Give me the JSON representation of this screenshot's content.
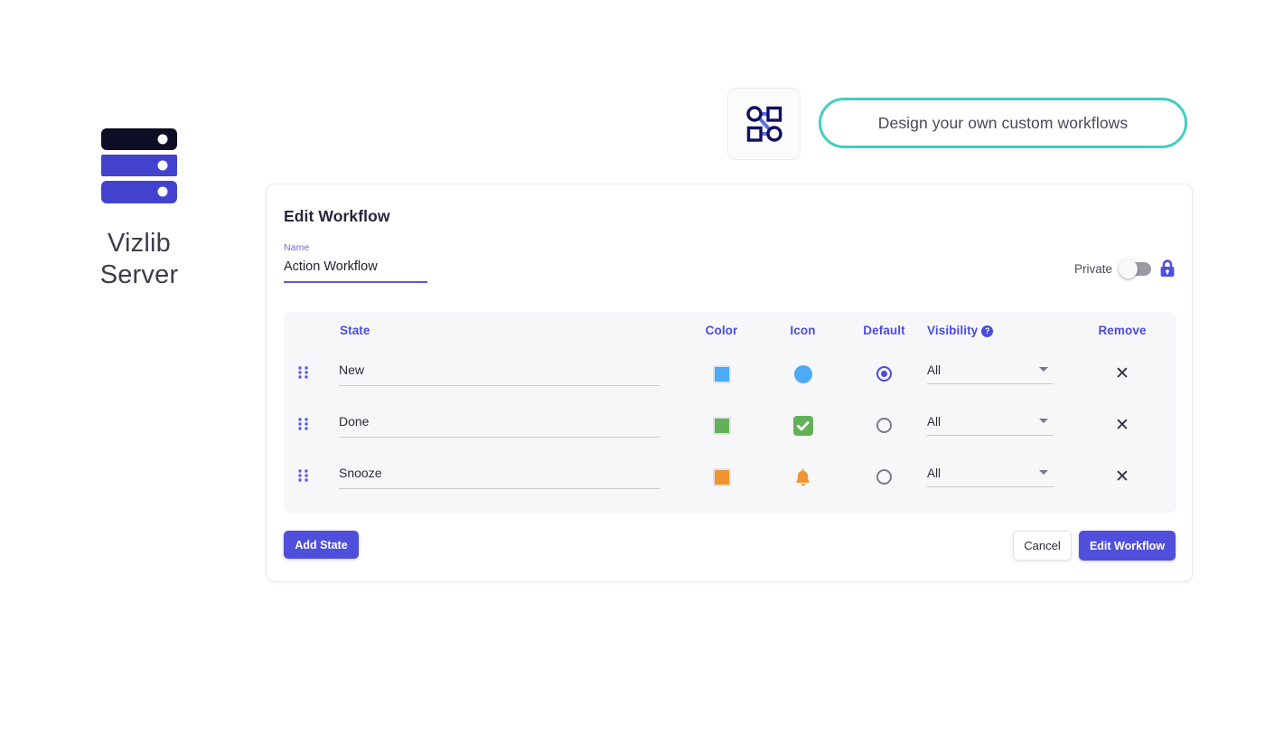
{
  "brand": {
    "logo_icon": "server-stack-icon",
    "name_line1": "Vizlib",
    "name_line2": "Server",
    "colors": {
      "dark": "#0d0d26",
      "indigo": "#4242cf"
    }
  },
  "promo": {
    "icon": "workflow-diagram-icon",
    "text": "Design your own custom workflows",
    "border_color": "#40cfc0"
  },
  "card": {
    "title": "Edit Workflow",
    "name_field": {
      "label": "Name",
      "value": "Action Workflow",
      "placeholder": "Name"
    },
    "private": {
      "label": "Private",
      "enabled": false,
      "lock_icon": "lock-icon"
    },
    "table": {
      "headers": {
        "state": "State",
        "color": "Color",
        "icon": "Icon",
        "default": "Default",
        "visibility": "Visibility",
        "visibility_help": "?",
        "remove": "Remove"
      },
      "rows": [
        {
          "state": "New",
          "color": "#4daaf5",
          "icon": "circle-icon",
          "icon_color": "#4daaf5",
          "is_default": true,
          "visibility": "All",
          "remove_icon": "close-icon"
        },
        {
          "state": "Done",
          "color": "#62b158",
          "icon": "check-square-icon",
          "icon_color": "#62b158",
          "is_default": false,
          "visibility": "All",
          "remove_icon": "close-icon"
        },
        {
          "state": "Snooze",
          "color": "#ef9430",
          "icon": "bell-icon",
          "icon_color": "#ef9430",
          "is_default": false,
          "visibility": "All",
          "remove_icon": "close-icon"
        }
      ]
    },
    "footer": {
      "add_state": "Add State",
      "cancel": "Cancel",
      "submit": "Edit Workflow"
    }
  },
  "theme": {
    "accent": "#4f4fdb",
    "header_text": "#4b4be0",
    "teal": "#40cfc0"
  }
}
